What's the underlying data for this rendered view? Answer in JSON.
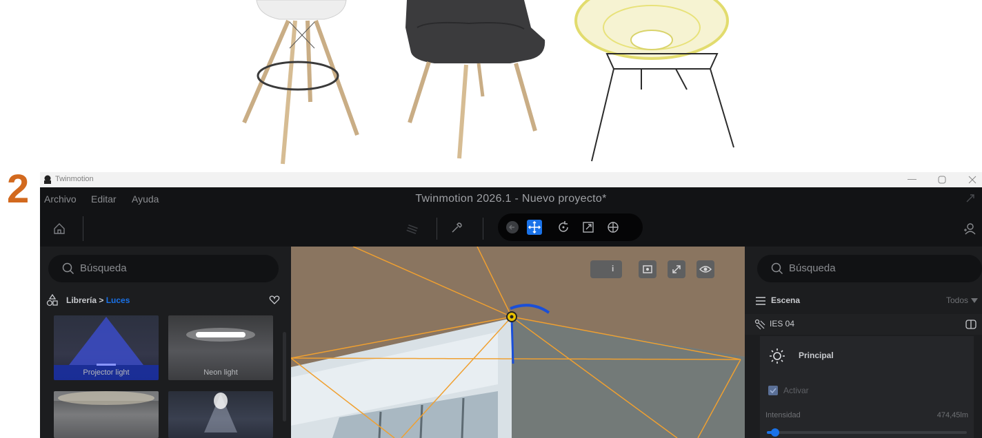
{
  "step_number": "2",
  "window": {
    "app_name": "Twinmotion",
    "title": "Twinmotion 2026.1 - Nuevo proyecto*"
  },
  "menu": [
    "Archivo",
    "Editar",
    "Ayuda"
  ],
  "toolbar": {
    "icons": [
      "home-icon",
      "layers-icon",
      "eyedropper-icon",
      "back-icon",
      "move-icon",
      "rotate-icon",
      "scale-icon",
      "globe-icon",
      "user-icon"
    ],
    "active_tool": "move"
  },
  "library": {
    "search_placeholder": "Búsqueda",
    "breadcrumb_root": "Librería",
    "breadcrumb_separator": ">",
    "breadcrumb_current": "Luces",
    "items": [
      {
        "label": "Projector light"
      },
      {
        "label": "Neon light"
      },
      {
        "label": ""
      },
      {
        "label": ""
      }
    ]
  },
  "scene": {
    "search_placeholder": "Búsqueda",
    "title": "Escena",
    "filter": "Todos",
    "selected_item": "IES 04",
    "section": "Principal",
    "activate_label": "Activar",
    "activate_checked": true,
    "intensity_label": "Intensidad",
    "intensity_value": "474,45lm",
    "intensity_fraction": 0.04
  },
  "colors": {
    "accent": "#1a72e8",
    "step": "#d2691e",
    "gizmo": "#f0a030"
  }
}
